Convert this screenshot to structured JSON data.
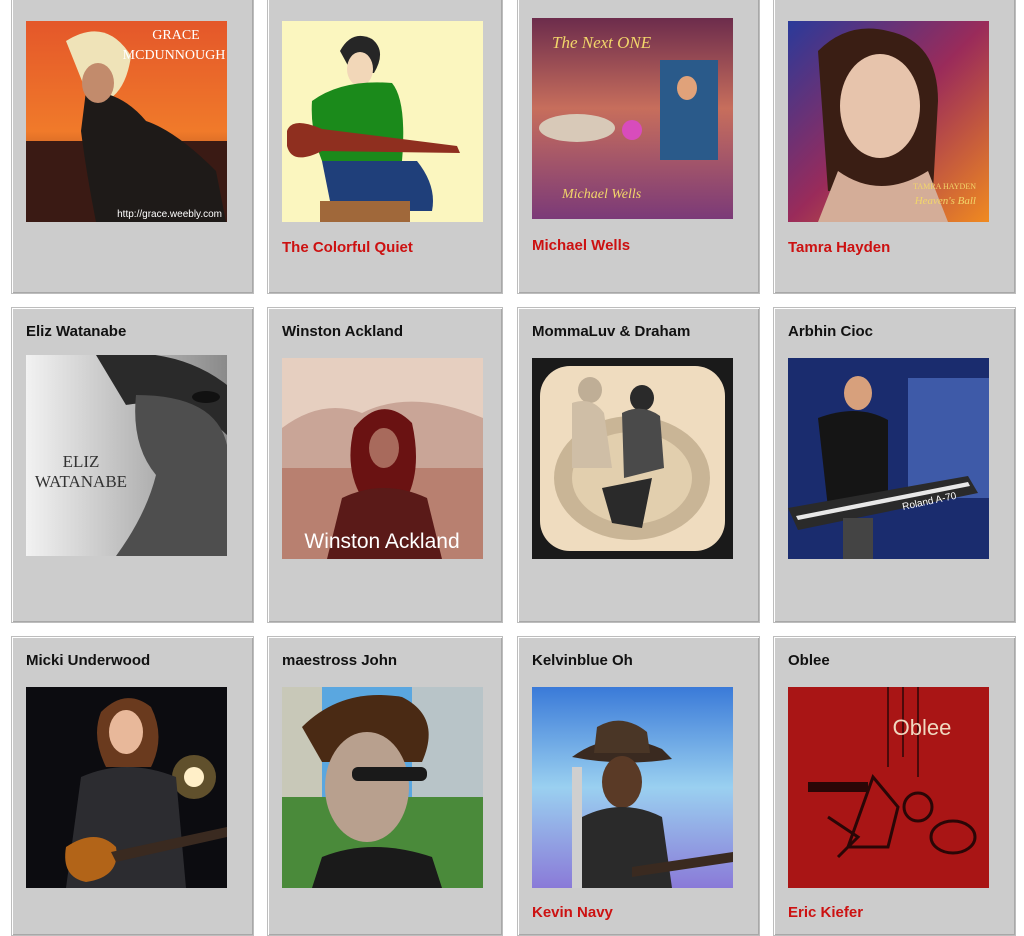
{
  "row1": [
    {
      "img_caption_top": "GRACE",
      "img_caption_bottom": "MCDUNNOUGH",
      "img_url_text": "http://grace.weebly.com",
      "link": ""
    },
    {
      "link": "The Colorful Quiet"
    },
    {
      "img_caption": "The Next ONE",
      "img_signature": "Michael Wells",
      "link": "Michael Wells"
    },
    {
      "img_caption_a": "TAMRA HAYDEN",
      "img_caption_b": "Heaven's Ball",
      "link": "Tamra Hayden"
    }
  ],
  "row2": [
    {
      "title": "Eliz Watanabe",
      "img_line1": "ELIZ",
      "img_line2": "WATANABE"
    },
    {
      "title": "Winston Ackland",
      "img_caption": "Winston Ackland"
    },
    {
      "title": "MommaLuv & Draham"
    },
    {
      "title": "Arbhin Cioc",
      "img_caption": "Roland A-70"
    }
  ],
  "row3": [
    {
      "title": "Micki Underwood"
    },
    {
      "title": "maestross John"
    },
    {
      "title": "Kelvinblue Oh",
      "link": "Kevin Navy"
    },
    {
      "title": "Oblee",
      "img_caption": "Oblee",
      "link": "Eric Kiefer"
    }
  ]
}
